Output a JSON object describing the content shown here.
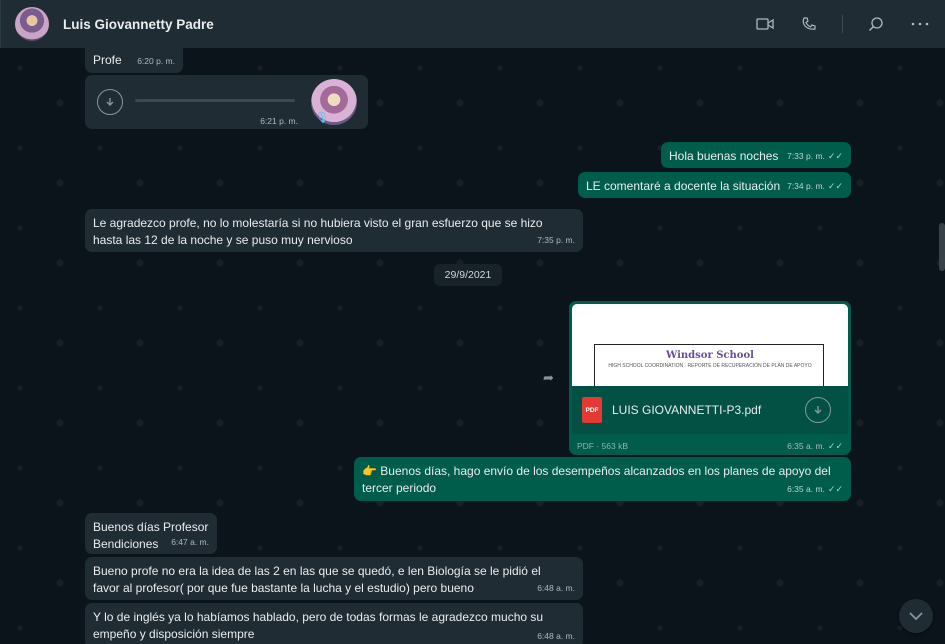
{
  "header": {
    "contact_name": "Luis Giovannetty Padre",
    "icons": [
      "video-call-icon",
      "voice-call-icon",
      "search-icon",
      "menu-icon"
    ]
  },
  "messages": {
    "profe": {
      "text": "Profe",
      "time": "6:20 p. m."
    },
    "audio": {
      "time": "6:21 p. m."
    },
    "hola": {
      "text": "Hola buenas noches",
      "time": "7:33 p. m."
    },
    "le_comentare": {
      "text": "LE comentaré a docente la situación",
      "time": "7:34 p. m."
    },
    "agradezco": {
      "text": "Le agradezco profe, no lo molestaría si no hubiera visto el gran esfuerzo que se hizo hasta las 12 de la noche y se puso muy nervioso",
      "time": "7:35 p. m."
    },
    "date_divider": "29/9/2021",
    "doc": {
      "school": "Windsor School",
      "school_sub": "HIGH SCHOOL COORDINATION · REPORTE DE RECUPERACIÓN DE PLAN DE APOYO",
      "pdf_label": "PDF",
      "file_name": "LUIS GIOVANNETTI-P3.pdf",
      "meta": "PDF · 563 kB",
      "time": "6:35 a. m."
    },
    "envio": {
      "emoji": "👉",
      "text": "Buenos días, hago envío de los desempeños alcanzados en los planes de apoyo del tercer periodo",
      "time": "6:35 a. m."
    },
    "buenos_dias": {
      "line1": "Buenos días Profesor",
      "line2": "Bendiciones",
      "time": "6:47 a. m."
    },
    "bueno_profe": {
      "text": "Bueno profe no era la idea de las 2 en las que se quedó, e len Biología se le pidió el favor al profesor( por que fue bastante la lucha y el estudio) pero bueno",
      "time": "6:48 a. m."
    },
    "ingles": {
      "text": "Y lo de inglés ya lo habíamos hablado, pero de todas formas le agradezco mucho su empeño y disposición siempre",
      "time": "6:48 a. m."
    }
  },
  "colors": {
    "incoming": "#202c33",
    "outgoing": "#005c4b",
    "background": "#0b141a"
  }
}
